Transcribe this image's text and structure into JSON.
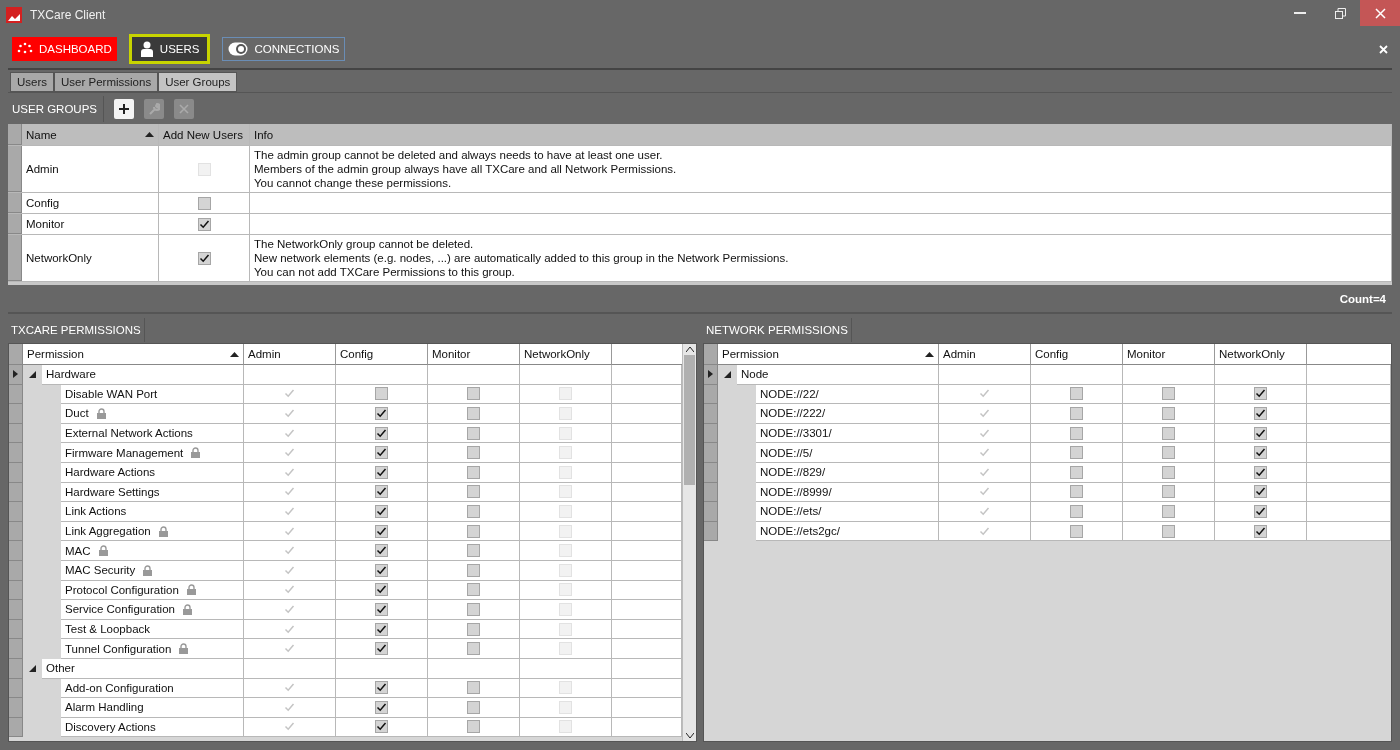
{
  "window": {
    "title": "TXCare Client"
  },
  "nav": [
    {
      "label": "DASHBOARD",
      "kind": "filled",
      "color": "#ff0000",
      "selected": false
    },
    {
      "label": "USERS",
      "kind": "outlined",
      "color": "#c8d400",
      "selected": true
    },
    {
      "label": "CONNECTIONS",
      "kind": "outlined",
      "color": "#6a8db5",
      "selected": false
    }
  ],
  "tabs": [
    {
      "label": "Users",
      "selected": false
    },
    {
      "label": "User Permissions",
      "selected": false
    },
    {
      "label": "User Groups",
      "selected": true
    }
  ],
  "user_groups": {
    "title": "USER GROUPS",
    "toolbar": [
      {
        "kind": "add",
        "disabled": false
      },
      {
        "kind": "edit",
        "disabled": true
      },
      {
        "kind": "delete",
        "disabled": true
      }
    ],
    "columns": [
      "Name",
      "Add New Users",
      "Info"
    ],
    "rows": [
      {
        "name": "Admin",
        "add_new_users": {
          "checked": false,
          "disabled": true
        },
        "info": [
          "The admin group cannot be deleted and always needs to have at least one user.",
          "Members of the admin group always have all TXCare and all Network Permissions.",
          "You cannot change these permissions."
        ]
      },
      {
        "name": "Config",
        "add_new_users": {
          "checked": false,
          "disabled": false
        },
        "info": []
      },
      {
        "name": "Monitor",
        "add_new_users": {
          "checked": true,
          "disabled": false
        },
        "info": []
      },
      {
        "name": "NetworkOnly",
        "add_new_users": {
          "checked": true,
          "disabled": false
        },
        "info": [
          "The NetworkOnly group cannot be deleted.",
          "New network elements (e.g. nodes, ...) are automatically added to this group in the Network Permissions.",
          "You can not add TXCare Permissions to this group."
        ]
      }
    ],
    "count": "Count=4"
  },
  "panels": [
    {
      "title": "TXCARE PERMISSIONS",
      "scrollable": true,
      "columns": [
        "Permission",
        "Admin",
        "Config",
        "Monitor",
        "NetworkOnly"
      ],
      "groups": [
        {
          "name": "Hardware",
          "expanded": true,
          "current": true,
          "children": [
            {
              "name": "Disable WAN Port",
              "locked": false,
              "checks": [
                {
                  "checked": true,
                  "disabled": true
                },
                {
                  "checked": false,
                  "disabled": false
                },
                {
                  "checked": false,
                  "disabled": false
                },
                {
                  "checked": false,
                  "disabled": true
                }
              ]
            },
            {
              "name": "Duct",
              "locked": true,
              "checks": [
                {
                  "checked": true,
                  "disabled": true
                },
                {
                  "checked": true,
                  "disabled": false
                },
                {
                  "checked": false,
                  "disabled": false
                },
                {
                  "checked": false,
                  "disabled": true
                }
              ]
            },
            {
              "name": "External Network Actions",
              "locked": false,
              "checks": [
                {
                  "checked": true,
                  "disabled": true
                },
                {
                  "checked": true,
                  "disabled": false
                },
                {
                  "checked": false,
                  "disabled": false
                },
                {
                  "checked": false,
                  "disabled": true
                }
              ]
            },
            {
              "name": "Firmware Management",
              "locked": true,
              "checks": [
                {
                  "checked": true,
                  "disabled": true
                },
                {
                  "checked": true,
                  "disabled": false
                },
                {
                  "checked": false,
                  "disabled": false
                },
                {
                  "checked": false,
                  "disabled": true
                }
              ]
            },
            {
              "name": "Hardware Actions",
              "locked": false,
              "checks": [
                {
                  "checked": true,
                  "disabled": true
                },
                {
                  "checked": true,
                  "disabled": false
                },
                {
                  "checked": false,
                  "disabled": false
                },
                {
                  "checked": false,
                  "disabled": true
                }
              ]
            },
            {
              "name": "Hardware Settings",
              "locked": false,
              "checks": [
                {
                  "checked": true,
                  "disabled": true
                },
                {
                  "checked": true,
                  "disabled": false
                },
                {
                  "checked": false,
                  "disabled": false
                },
                {
                  "checked": false,
                  "disabled": true
                }
              ]
            },
            {
              "name": "Link Actions",
              "locked": false,
              "checks": [
                {
                  "checked": true,
                  "disabled": true
                },
                {
                  "checked": true,
                  "disabled": false
                },
                {
                  "checked": false,
                  "disabled": false
                },
                {
                  "checked": false,
                  "disabled": true
                }
              ]
            },
            {
              "name": "Link Aggregation",
              "locked": true,
              "checks": [
                {
                  "checked": true,
                  "disabled": true
                },
                {
                  "checked": true,
                  "disabled": false
                },
                {
                  "checked": false,
                  "disabled": false
                },
                {
                  "checked": false,
                  "disabled": true
                }
              ]
            },
            {
              "name": "MAC",
              "locked": true,
              "checks": [
                {
                  "checked": true,
                  "disabled": true
                },
                {
                  "checked": true,
                  "disabled": false
                },
                {
                  "checked": false,
                  "disabled": false
                },
                {
                  "checked": false,
                  "disabled": true
                }
              ]
            },
            {
              "name": "MAC Security",
              "locked": true,
              "checks": [
                {
                  "checked": true,
                  "disabled": true
                },
                {
                  "checked": true,
                  "disabled": false
                },
                {
                  "checked": false,
                  "disabled": false
                },
                {
                  "checked": false,
                  "disabled": true
                }
              ]
            },
            {
              "name": "Protocol Configuration",
              "locked": true,
              "checks": [
                {
                  "checked": true,
                  "disabled": true
                },
                {
                  "checked": true,
                  "disabled": false
                },
                {
                  "checked": false,
                  "disabled": false
                },
                {
                  "checked": false,
                  "disabled": true
                }
              ]
            },
            {
              "name": "Service Configuration",
              "locked": true,
              "checks": [
                {
                  "checked": true,
                  "disabled": true
                },
                {
                  "checked": true,
                  "disabled": false
                },
                {
                  "checked": false,
                  "disabled": false
                },
                {
                  "checked": false,
                  "disabled": true
                }
              ]
            },
            {
              "name": "Test & Loopback",
              "locked": false,
              "checks": [
                {
                  "checked": true,
                  "disabled": true
                },
                {
                  "checked": true,
                  "disabled": false
                },
                {
                  "checked": false,
                  "disabled": false
                },
                {
                  "checked": false,
                  "disabled": true
                }
              ]
            },
            {
              "name": "Tunnel Configuration",
              "locked": true,
              "checks": [
                {
                  "checked": true,
                  "disabled": true
                },
                {
                  "checked": true,
                  "disabled": false
                },
                {
                  "checked": false,
                  "disabled": false
                },
                {
                  "checked": false,
                  "disabled": true
                }
              ]
            }
          ]
        },
        {
          "name": "Other",
          "expanded": true,
          "current": false,
          "children": [
            {
              "name": "Add-on Configuration",
              "locked": false,
              "checks": [
                {
                  "checked": true,
                  "disabled": true
                },
                {
                  "checked": true,
                  "disabled": false
                },
                {
                  "checked": false,
                  "disabled": false
                },
                {
                  "checked": false,
                  "disabled": true
                }
              ]
            },
            {
              "name": "Alarm Handling",
              "locked": false,
              "checks": [
                {
                  "checked": true,
                  "disabled": true
                },
                {
                  "checked": true,
                  "disabled": false
                },
                {
                  "checked": false,
                  "disabled": false
                },
                {
                  "checked": false,
                  "disabled": true
                }
              ]
            },
            {
              "name": "Discovery Actions",
              "locked": false,
              "checks": [
                {
                  "checked": true,
                  "disabled": true
                },
                {
                  "checked": true,
                  "disabled": false
                },
                {
                  "checked": false,
                  "disabled": false
                },
                {
                  "checked": false,
                  "disabled": true
                }
              ]
            }
          ]
        }
      ]
    },
    {
      "title": "NETWORK PERMISSIONS",
      "scrollable": false,
      "columns": [
        "Permission",
        "Admin",
        "Config",
        "Monitor",
        "NetworkOnly"
      ],
      "groups": [
        {
          "name": "Node",
          "expanded": true,
          "current": true,
          "children": [
            {
              "name": "NODE://22/",
              "locked": false,
              "checks": [
                {
                  "checked": true,
                  "disabled": true
                },
                {
                  "checked": false,
                  "disabled": false
                },
                {
                  "checked": false,
                  "disabled": false
                },
                {
                  "checked": true,
                  "disabled": false
                }
              ]
            },
            {
              "name": "NODE://222/",
              "locked": false,
              "checks": [
                {
                  "checked": true,
                  "disabled": true
                },
                {
                  "checked": false,
                  "disabled": false
                },
                {
                  "checked": false,
                  "disabled": false
                },
                {
                  "checked": true,
                  "disabled": false
                }
              ]
            },
            {
              "name": "NODE://3301/",
              "locked": false,
              "checks": [
                {
                  "checked": true,
                  "disabled": true
                },
                {
                  "checked": false,
                  "disabled": false
                },
                {
                  "checked": false,
                  "disabled": false
                },
                {
                  "checked": true,
                  "disabled": false
                }
              ]
            },
            {
              "name": "NODE://5/",
              "locked": false,
              "checks": [
                {
                  "checked": true,
                  "disabled": true
                },
                {
                  "checked": false,
                  "disabled": false
                },
                {
                  "checked": false,
                  "disabled": false
                },
                {
                  "checked": true,
                  "disabled": false
                }
              ]
            },
            {
              "name": "NODE://829/",
              "locked": false,
              "checks": [
                {
                  "checked": true,
                  "disabled": true
                },
                {
                  "checked": false,
                  "disabled": false
                },
                {
                  "checked": false,
                  "disabled": false
                },
                {
                  "checked": true,
                  "disabled": false
                }
              ]
            },
            {
              "name": "NODE://8999/",
              "locked": false,
              "checks": [
                {
                  "checked": true,
                  "disabled": true
                },
                {
                  "checked": false,
                  "disabled": false
                },
                {
                  "checked": false,
                  "disabled": false
                },
                {
                  "checked": true,
                  "disabled": false
                }
              ]
            },
            {
              "name": "NODE://ets/",
              "locked": false,
              "checks": [
                {
                  "checked": true,
                  "disabled": true
                },
                {
                  "checked": false,
                  "disabled": false
                },
                {
                  "checked": false,
                  "disabled": false
                },
                {
                  "checked": true,
                  "disabled": false
                }
              ]
            },
            {
              "name": "NODE://ets2gc/",
              "locked": false,
              "checks": [
                {
                  "checked": true,
                  "disabled": true
                },
                {
                  "checked": false,
                  "disabled": false
                },
                {
                  "checked": false,
                  "disabled": false
                },
                {
                  "checked": true,
                  "disabled": false
                }
              ]
            }
          ]
        }
      ]
    }
  ]
}
